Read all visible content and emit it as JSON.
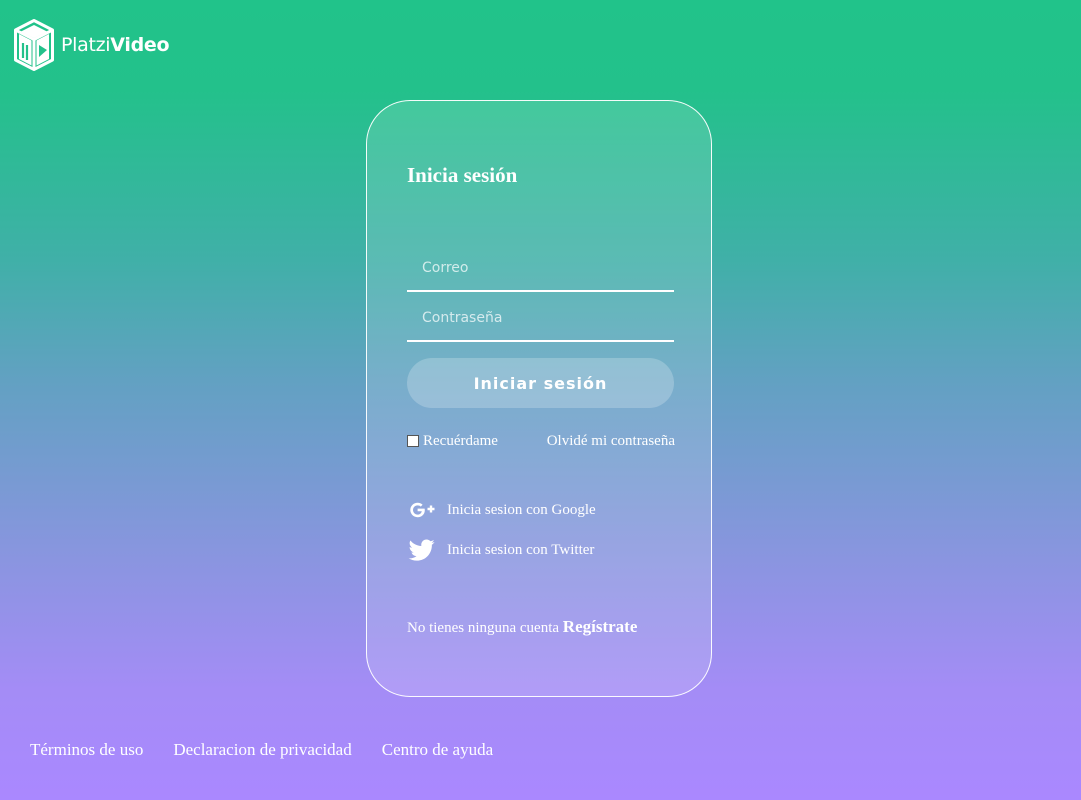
{
  "brand": {
    "name_regular": "Platzi",
    "name_bold": "Video",
    "icon": "platzi-cube-logo"
  },
  "login": {
    "title": "Inicia sesión",
    "email_placeholder": "Correo",
    "password_placeholder": "Contraseña",
    "submit_label": "Iniciar sesión",
    "remember_label": "Recuérdame",
    "forgot_label": "Olvidé mi contraseña",
    "google_label": "Inicia sesion con Google",
    "google_icon": "google-plus-icon",
    "twitter_label": "Inicia sesion con Twitter",
    "twitter_icon": "twitter-bird-icon",
    "no_account_text": "No tienes ninguna cuenta",
    "register_label": "Regístrate"
  },
  "footer": {
    "links": [
      "Términos de uso",
      "Declaracion de privacidad",
      "Centro de ayuda"
    ]
  },
  "colors": {
    "gradient_top": "#21c38a",
    "gradient_bottom": "#aa88ff",
    "text": "#ffffff"
  }
}
